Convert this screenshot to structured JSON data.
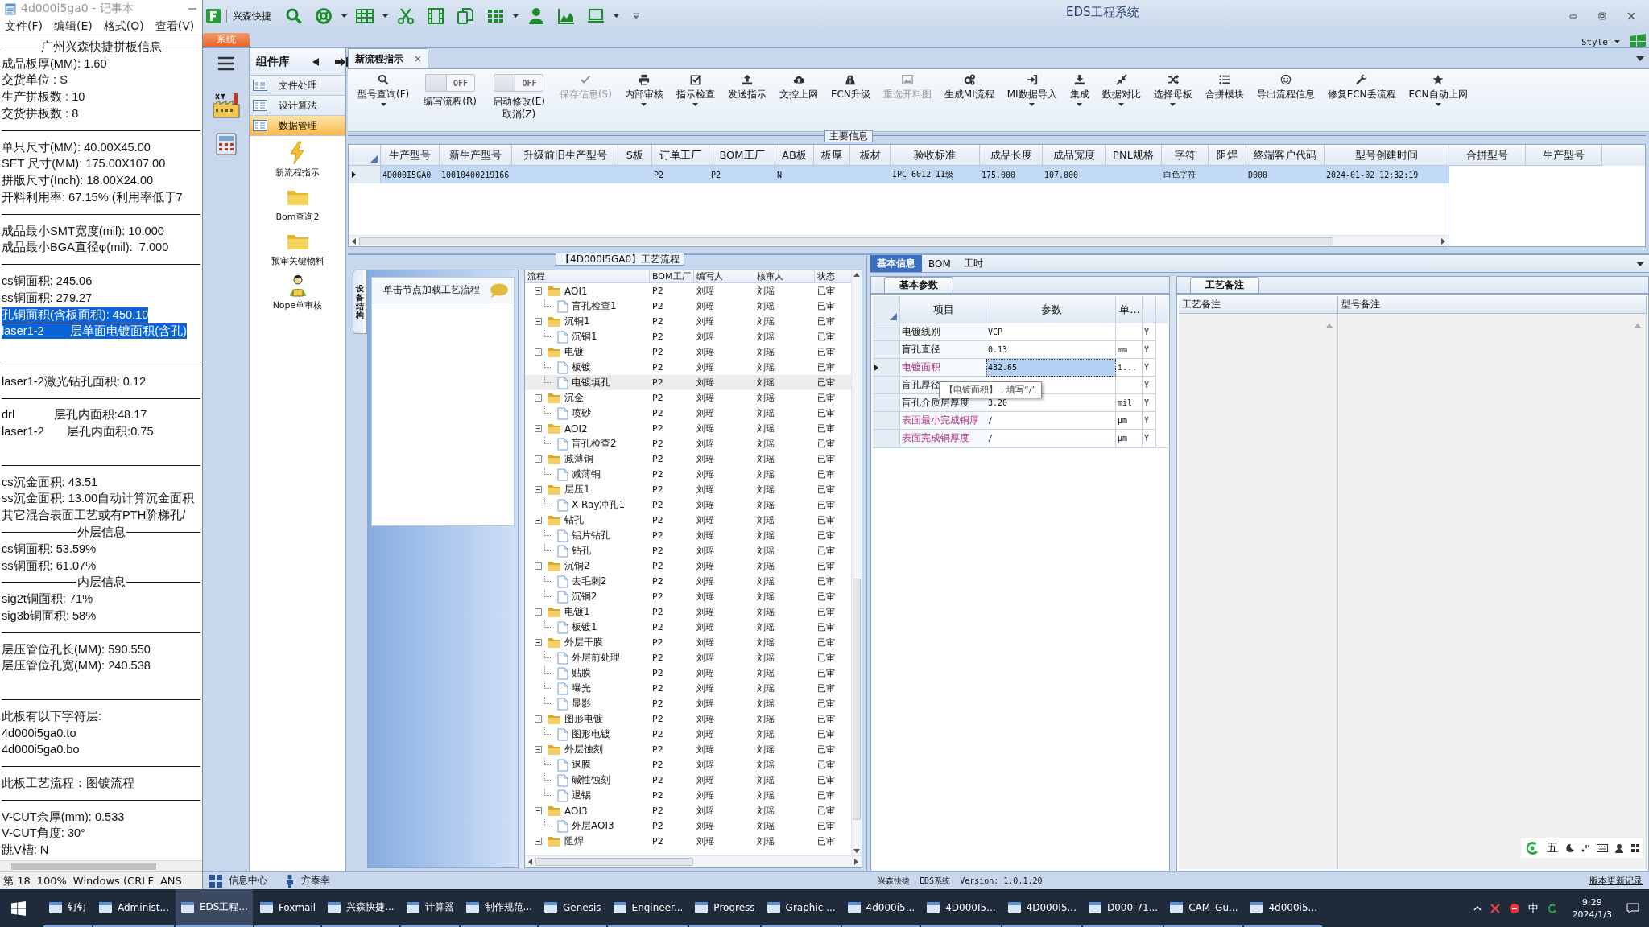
{
  "notepad": {
    "title": "4d000i5ga0 - 记事本",
    "menu": [
      "文件(F)",
      "编辑(E)",
      "格式(O)",
      "查看(V)"
    ],
    "lines": [
      {
        "kind": "heading",
        "text": "广州兴森快捷拼板信息"
      },
      {
        "kind": "text",
        "text": "成品板厚(MM): 1.60",
        "selected": false
      },
      {
        "kind": "text",
        "text": "交货单位 : S",
        "selected": false
      },
      {
        "kind": "text",
        "text": "生产拼板数 : 10",
        "selected": false
      },
      {
        "kind": "text",
        "text": "交货拼板数 : 8",
        "selected": false
      },
      {
        "kind": "rule"
      },
      {
        "kind": "text",
        "text": "单只尺寸(MM): 40.00X45.00",
        "selected": false
      },
      {
        "kind": "text",
        "text": "SET 尺寸(MM): 175.00X107.00",
        "selected": false
      },
      {
        "kind": "text",
        "text": "拼版尺寸(Inch): 18.00X24.00",
        "selected": false
      },
      {
        "kind": "text",
        "text": "开料利用率: 67.15% (利用率低于7",
        "selected": false
      },
      {
        "kind": "rule"
      },
      {
        "kind": "text",
        "text": "成品最小SMT宽度(mil): 10.000",
        "selected": false
      },
      {
        "kind": "text",
        "text": "成品最小BGA直径φ(mil):  7.000",
        "selected": false
      },
      {
        "kind": "rule"
      },
      {
        "kind": "text",
        "text": "cs铜面积: 245.06",
        "selected": false
      },
      {
        "kind": "text",
        "text": "ss铜面积: 279.27",
        "selected": false
      },
      {
        "kind": "text",
        "text": "孔铜面积(含板面积): 450.10",
        "selected": true
      },
      {
        "kind": "text",
        "text": "laser1-2        层单面电镀面积(含孔)",
        "selected": true
      },
      {
        "kind": "blank"
      },
      {
        "kind": "rule"
      },
      {
        "kind": "text",
        "text": "laser1-2激光钻孔面积: 0.12",
        "selected": false
      },
      {
        "kind": "rule"
      },
      {
        "kind": "text",
        "text": "drl            层孔内面积:48.17",
        "selected": false
      },
      {
        "kind": "text",
        "text": "laser1-2       层孔内面积:0.75",
        "selected": false
      },
      {
        "kind": "blank"
      },
      {
        "kind": "rule"
      },
      {
        "kind": "text",
        "text": "cs沉金面积: 43.51",
        "selected": false
      },
      {
        "kind": "text",
        "text": "ss沉金面积: 13.00自动计算沉金面积",
        "selected": false
      },
      {
        "kind": "text",
        "text": "其它混合表面工艺或有PTH阶梯孔/",
        "selected": false
      },
      {
        "kind": "heading",
        "text": "外层信息"
      },
      {
        "kind": "text",
        "text": "cs铜面积: 53.59%",
        "selected": false
      },
      {
        "kind": "text",
        "text": "ss铜面积: 61.07%",
        "selected": false
      },
      {
        "kind": "heading",
        "text": "内层信息"
      },
      {
        "kind": "text",
        "text": "sig2t铜面积: 71%",
        "selected": false
      },
      {
        "kind": "text",
        "text": "sig3b铜面积: 58%",
        "selected": false
      },
      {
        "kind": "rule"
      },
      {
        "kind": "text",
        "text": "层压管位孔长(MM): 590.550",
        "selected": false
      },
      {
        "kind": "text",
        "text": "层压管位孔宽(MM): 240.538",
        "selected": false
      },
      {
        "kind": "blank"
      },
      {
        "kind": "rule"
      },
      {
        "kind": "text",
        "text": "此板有以下字符层:",
        "selected": false
      },
      {
        "kind": "text",
        "text": "4d000i5ga0.to",
        "selected": false
      },
      {
        "kind": "text",
        "text": "4d000i5ga0.bo",
        "selected": false
      },
      {
        "kind": "rule"
      },
      {
        "kind": "text",
        "text": "此板工艺流程：图镀流程",
        "selected": false
      },
      {
        "kind": "rule"
      },
      {
        "kind": "text",
        "text": "V-CUT余厚(mm): 0.533",
        "selected": false
      },
      {
        "kind": "text",
        "text": "V-CUT角度: 30°",
        "selected": false
      },
      {
        "kind": "text",
        "text": "跳V槽: N",
        "selected": false
      }
    ],
    "status": [
      "第 18",
      "100%",
      "Windows (CRLF",
      "ANS"
    ]
  },
  "eds": {
    "app_name": "兴森快捷",
    "title": "EDS工程系统",
    "app_tab": "系统",
    "style_label": "Style",
    "component_panel": {
      "title": "组件库",
      "items": [
        {
          "label": "文件处理",
          "selected": false
        },
        {
          "label": "设计算法",
          "selected": false
        },
        {
          "label": "数据管理",
          "selected": true
        }
      ],
      "launchers": [
        {
          "label": "新流程指示"
        },
        {
          "label": "Bom查询2"
        },
        {
          "label": "预审关键物料"
        },
        {
          "label": "Nope单审核"
        }
      ]
    },
    "doc_tab": {
      "label": "新流程指示"
    },
    "ribbon": [
      {
        "kind": "button",
        "label": "型号查询(F)",
        "disabled": false,
        "dropdown": true
      },
      {
        "kind": "toggle",
        "label": "编写流程(R)",
        "state_text": "OFF",
        "on": false
      },
      {
        "kind": "toggle",
        "label": "启动修改(E)\n取消(Z)",
        "state_text": "OFF",
        "on": false
      },
      {
        "kind": "button",
        "label": "保存信息(S)",
        "disabled": true,
        "dropdown": false
      },
      {
        "kind": "button",
        "label": "内部审核",
        "disabled": false,
        "dropdown": true
      },
      {
        "kind": "button",
        "label": "指示检查",
        "disabled": false,
        "dropdown": true
      },
      {
        "kind": "button",
        "label": "发送指示",
        "disabled": false,
        "dropdown": false
      },
      {
        "kind": "button",
        "label": "文控上网",
        "disabled": false,
        "dropdown": false
      },
      {
        "kind": "button",
        "label": "ECN升级",
        "disabled": false,
        "dropdown": false
      },
      {
        "kind": "button",
        "label": "重选开料图",
        "disabled": true,
        "dropdown": false
      },
      {
        "kind": "button",
        "label": "生成MI流程",
        "disabled": false,
        "dropdown": false
      },
      {
        "kind": "button",
        "label": "MI数据导入",
        "disabled": false,
        "dropdown": true
      },
      {
        "kind": "button",
        "label": "集成",
        "disabled": false,
        "dropdown": true
      },
      {
        "kind": "button",
        "label": "数据对比",
        "disabled": false,
        "dropdown": true
      },
      {
        "kind": "button",
        "label": "选择母板",
        "disabled": false,
        "dropdown": true
      },
      {
        "kind": "button",
        "label": "合拼模块",
        "disabled": false,
        "dropdown": false
      },
      {
        "kind": "button",
        "label": "导出流程信息",
        "disabled": false,
        "dropdown": false
      },
      {
        "kind": "button",
        "label": "修复ECN丢流程",
        "disabled": false,
        "dropdown": false
      },
      {
        "kind": "button",
        "label": "ECN自动上网",
        "disabled": false,
        "dropdown": true
      }
    ],
    "main_info": {
      "caption": "主要信息",
      "columns": [
        "生产型号",
        "新生产型号",
        "升级前旧生产型号",
        "S板",
        "订单工厂",
        "BOM工厂",
        "AB板",
        "板厚",
        "板材",
        "验收标准",
        "成品长度",
        "成品宽度",
        "PNL规格",
        "字符",
        "阻焊",
        "终端客户代码",
        "型号创建时间"
      ],
      "rows": [
        {
          "selected": true,
          "cells": [
            "4D000I5GA0",
            "10010400219166",
            null,
            null,
            "P2",
            "P2",
            "N",
            null,
            null,
            "IPC-6012 II级",
            "175.000",
            "107.000",
            null,
            "白色字符",
            null,
            "D000",
            "2024-01-02 12:32:19"
          ]
        }
      ],
      "side_columns": [
        "合拼型号",
        "生产型号"
      ]
    },
    "flow": {
      "caption": "【4D000I5GA0】工艺流程",
      "side_tab": "设备结构",
      "hint": "单击节点加载工艺流程",
      "columns": [
        "流程",
        "BOM工厂",
        "编写人",
        "核审人",
        "状态"
      ],
      "tree": [
        {
          "name": "AOI1",
          "bom": "P2",
          "writer": "刘瑶",
          "reviewer": "刘瑶",
          "status": "已审",
          "expanded": true,
          "selected": false,
          "children": [
            {
              "name": "盲孔检查1",
              "bom": "P2",
              "writer": "刘瑶",
              "reviewer": "刘瑶",
              "status": "已审",
              "selected": false
            }
          ]
        },
        {
          "name": "沉铜1",
          "bom": "P2",
          "writer": "刘瑶",
          "reviewer": "刘瑶",
          "status": "已审",
          "expanded": true,
          "selected": false,
          "children": [
            {
              "name": "沉铜1",
              "bom": "P2",
              "writer": "刘瑶",
              "reviewer": "刘瑶",
              "status": "已审",
              "selected": false
            }
          ]
        },
        {
          "name": "电镀",
          "bom": "P2",
          "writer": "刘瑶",
          "reviewer": "刘瑶",
          "status": "已审",
          "expanded": true,
          "selected": false,
          "children": [
            {
              "name": "板镀",
              "bom": "P2",
              "writer": "刘瑶",
              "reviewer": "刘瑶",
              "status": "已审",
              "selected": false
            },
            {
              "name": "电镀填孔",
              "bom": "P2",
              "writer": "刘瑶",
              "reviewer": "刘瑶",
              "status": "已审",
              "selected": true
            }
          ]
        },
        {
          "name": "沉金",
          "bom": "P2",
          "writer": "刘瑶",
          "reviewer": "刘瑶",
          "status": "已审",
          "expanded": true,
          "selected": false,
          "children": [
            {
              "name": "喷砂",
              "bom": "P2",
              "writer": "刘瑶",
              "reviewer": "刘瑶",
              "status": "已审",
              "selected": false
            }
          ]
        },
        {
          "name": "AOI2",
          "bom": "P2",
          "writer": "刘瑶",
          "reviewer": "刘瑶",
          "status": "已审",
          "expanded": true,
          "selected": false,
          "children": [
            {
              "name": "盲孔检查2",
              "bom": "P2",
              "writer": "刘瑶",
              "reviewer": "刘瑶",
              "status": "已审",
              "selected": false
            }
          ]
        },
        {
          "name": "减薄铜",
          "bom": "P2",
          "writer": "刘瑶",
          "reviewer": "刘瑶",
          "status": "已审",
          "expanded": true,
          "selected": false,
          "children": [
            {
              "name": "减薄铜",
              "bom": "P2",
              "writer": "刘瑶",
              "reviewer": "刘瑶",
              "status": "已审",
              "selected": false
            }
          ]
        },
        {
          "name": "层压1",
          "bom": "P2",
          "writer": "刘瑶",
          "reviewer": "刘瑶",
          "status": "已审",
          "expanded": true,
          "selected": false,
          "children": [
            {
              "name": "X-Ray冲孔1",
              "bom": "P2",
              "writer": "刘瑶",
              "reviewer": "刘瑶",
              "status": "已审",
              "selected": false
            }
          ]
        },
        {
          "name": "钻孔",
          "bom": "P2",
          "writer": "刘瑶",
          "reviewer": "刘瑶",
          "status": "已审",
          "expanded": true,
          "selected": false,
          "children": [
            {
              "name": "铝片钻孔",
              "bom": "P2",
              "writer": "刘瑶",
              "reviewer": "刘瑶",
              "status": "已审",
              "selected": false
            },
            {
              "name": "钻孔",
              "bom": "P2",
              "writer": "刘瑶",
              "reviewer": "刘瑶",
              "status": "已审",
              "selected": false
            }
          ]
        },
        {
          "name": "沉铜2",
          "bom": "P2",
          "writer": "刘瑶",
          "reviewer": "刘瑶",
          "status": "已审",
          "expanded": true,
          "selected": false,
          "children": [
            {
              "name": "去毛刺2",
              "bom": "P2",
              "writer": "刘瑶",
              "reviewer": "刘瑶",
              "status": "已审",
              "selected": false
            },
            {
              "name": "沉铜2",
              "bom": "P2",
              "writer": "刘瑶",
              "reviewer": "刘瑶",
              "status": "已审",
              "selected": false
            }
          ]
        },
        {
          "name": "电镀1",
          "bom": "P2",
          "writer": "刘瑶",
          "reviewer": "刘瑶",
          "status": "已审",
          "expanded": true,
          "selected": false,
          "children": [
            {
              "name": "板镀1",
              "bom": "P2",
              "writer": "刘瑶",
              "reviewer": "刘瑶",
              "status": "已审",
              "selected": false
            }
          ]
        },
        {
          "name": "外层干膜",
          "bom": "P2",
          "writer": "刘瑶",
          "reviewer": "刘瑶",
          "status": "已审",
          "expanded": true,
          "selected": false,
          "children": [
            {
              "name": "外层前处理",
              "bom": "P2",
              "writer": "刘瑶",
              "reviewer": "刘瑶",
              "status": "已审",
              "selected": false
            },
            {
              "name": "贴膜",
              "bom": "P2",
              "writer": "刘瑶",
              "reviewer": "刘瑶",
              "status": "已审",
              "selected": false
            },
            {
              "name": "曝光",
              "bom": "P2",
              "writer": "刘瑶",
              "reviewer": "刘瑶",
              "status": "已审",
              "selected": false
            },
            {
              "name": "显影",
              "bom": "P2",
              "writer": "刘瑶",
              "reviewer": "刘瑶",
              "status": "已审",
              "selected": false
            }
          ]
        },
        {
          "name": "图形电镀",
          "bom": "P2",
          "writer": "刘瑶",
          "reviewer": "刘瑶",
          "status": "已审",
          "expanded": true,
          "selected": false,
          "children": [
            {
              "name": "图形电镀",
              "bom": "P2",
              "writer": "刘瑶",
              "reviewer": "刘瑶",
              "status": "已审",
              "selected": false
            }
          ]
        },
        {
          "name": "外层蚀刻",
          "bom": "P2",
          "writer": "刘瑶",
          "reviewer": "刘瑶",
          "status": "已审",
          "expanded": true,
          "selected": false,
          "children": [
            {
              "name": "退膜",
              "bom": "P2",
              "writer": "刘瑶",
              "reviewer": "刘瑶",
              "status": "已审",
              "selected": false
            },
            {
              "name": "碱性蚀刻",
              "bom": "P2",
              "writer": "刘瑶",
              "reviewer": "刘瑶",
              "status": "已审",
              "selected": false
            },
            {
              "name": "退锡",
              "bom": "P2",
              "writer": "刘瑶",
              "reviewer": "刘瑶",
              "status": "已审",
              "selected": false
            }
          ]
        },
        {
          "name": "AOI3",
          "bom": "P2",
          "writer": "刘瑶",
          "reviewer": "刘瑶",
          "status": "已审",
          "expanded": true,
          "selected": false,
          "children": [
            {
              "name": "外层AOI3",
              "bom": "P2",
              "writer": "刘瑶",
              "reviewer": "刘瑶",
              "status": "已审",
              "selected": false
            }
          ]
        },
        {
          "name": "阻焊",
          "bom": "P2",
          "writer": "刘瑶",
          "reviewer": "刘瑶",
          "status": "已审",
          "expanded": true,
          "selected": false
        }
      ]
    },
    "detail": {
      "tabs": [
        {
          "label": "基本信息",
          "selected": true
        },
        {
          "label": "BOM",
          "selected": false
        },
        {
          "label": "工时",
          "selected": false
        }
      ],
      "params_tab": "基本参数",
      "param_columns": [
        "项目",
        "参数",
        "单..."
      ],
      "params": [
        {
          "item": "电镀线别",
          "value": "VCP",
          "flag": "Y",
          "required": false,
          "selected": false
        },
        {
          "item": "盲孔直径",
          "value": "0.13",
          "unit": "mm",
          "flag": "Y",
          "required": false,
          "selected": false
        },
        {
          "item": "电镀面积",
          "value": "432.65",
          "unit": "i...",
          "flag": "Y",
          "required": true,
          "selected": true
        },
        {
          "item": "盲孔厚径",
          "flag": "Y",
          "required": false,
          "selected": false
        },
        {
          "item": "盲孔介质层厚度",
          "value": "3.20",
          "unit": "mil",
          "flag": "Y",
          "required": false,
          "selected": false
        },
        {
          "item": "表面最小完成铜厚",
          "value": "/",
          "unit": "μm",
          "flag": "Y",
          "required": true,
          "selected": false
        },
        {
          "item": "表面完成铜厚度",
          "value": "/",
          "unit": "μm",
          "flag": "Y",
          "required": true,
          "selected": false
        }
      ],
      "tooltip": "【电镀面积】：填写“/”",
      "notes_tab": "工艺备注",
      "notes_columns": [
        "工艺备注",
        "型号备注"
      ]
    },
    "ime": {
      "mode": "五"
    },
    "status_bar": {
      "info_center": "信息中心",
      "user": "方泰幸",
      "version": "兴森快捷  EDS系统  Version: 1.0.1.20",
      "changelog": "版本更新记录"
    }
  },
  "taskbar": {
    "items": [
      {
        "label": "钉钉",
        "selected": false
      },
      {
        "label": "Administ...",
        "selected": false
      },
      {
        "label": "EDS工程...",
        "selected": true
      },
      {
        "label": "Foxmail",
        "selected": false
      },
      {
        "label": "兴森快捷...",
        "selected": false
      },
      {
        "label": "计算器",
        "selected": false
      },
      {
        "label": "制作规范...",
        "selected": false
      },
      {
        "label": "Genesis",
        "selected": false
      },
      {
        "label": "Engineer...",
        "selected": false
      },
      {
        "label": "Progress",
        "selected": false
      },
      {
        "label": "Graphic ...",
        "selected": false
      },
      {
        "label": "4d000i5...",
        "selected": false
      },
      {
        "label": "4D000I5...",
        "selected": false
      },
      {
        "label": "4D000I5...",
        "selected": false
      },
      {
        "label": "D000-71...",
        "selected": false
      },
      {
        "label": "CAM_Gu...",
        "selected": false
      },
      {
        "label": "4d000i5...",
        "selected": false
      }
    ],
    "lang": "中",
    "time": "9:29",
    "date": "2024/1/3"
  }
}
